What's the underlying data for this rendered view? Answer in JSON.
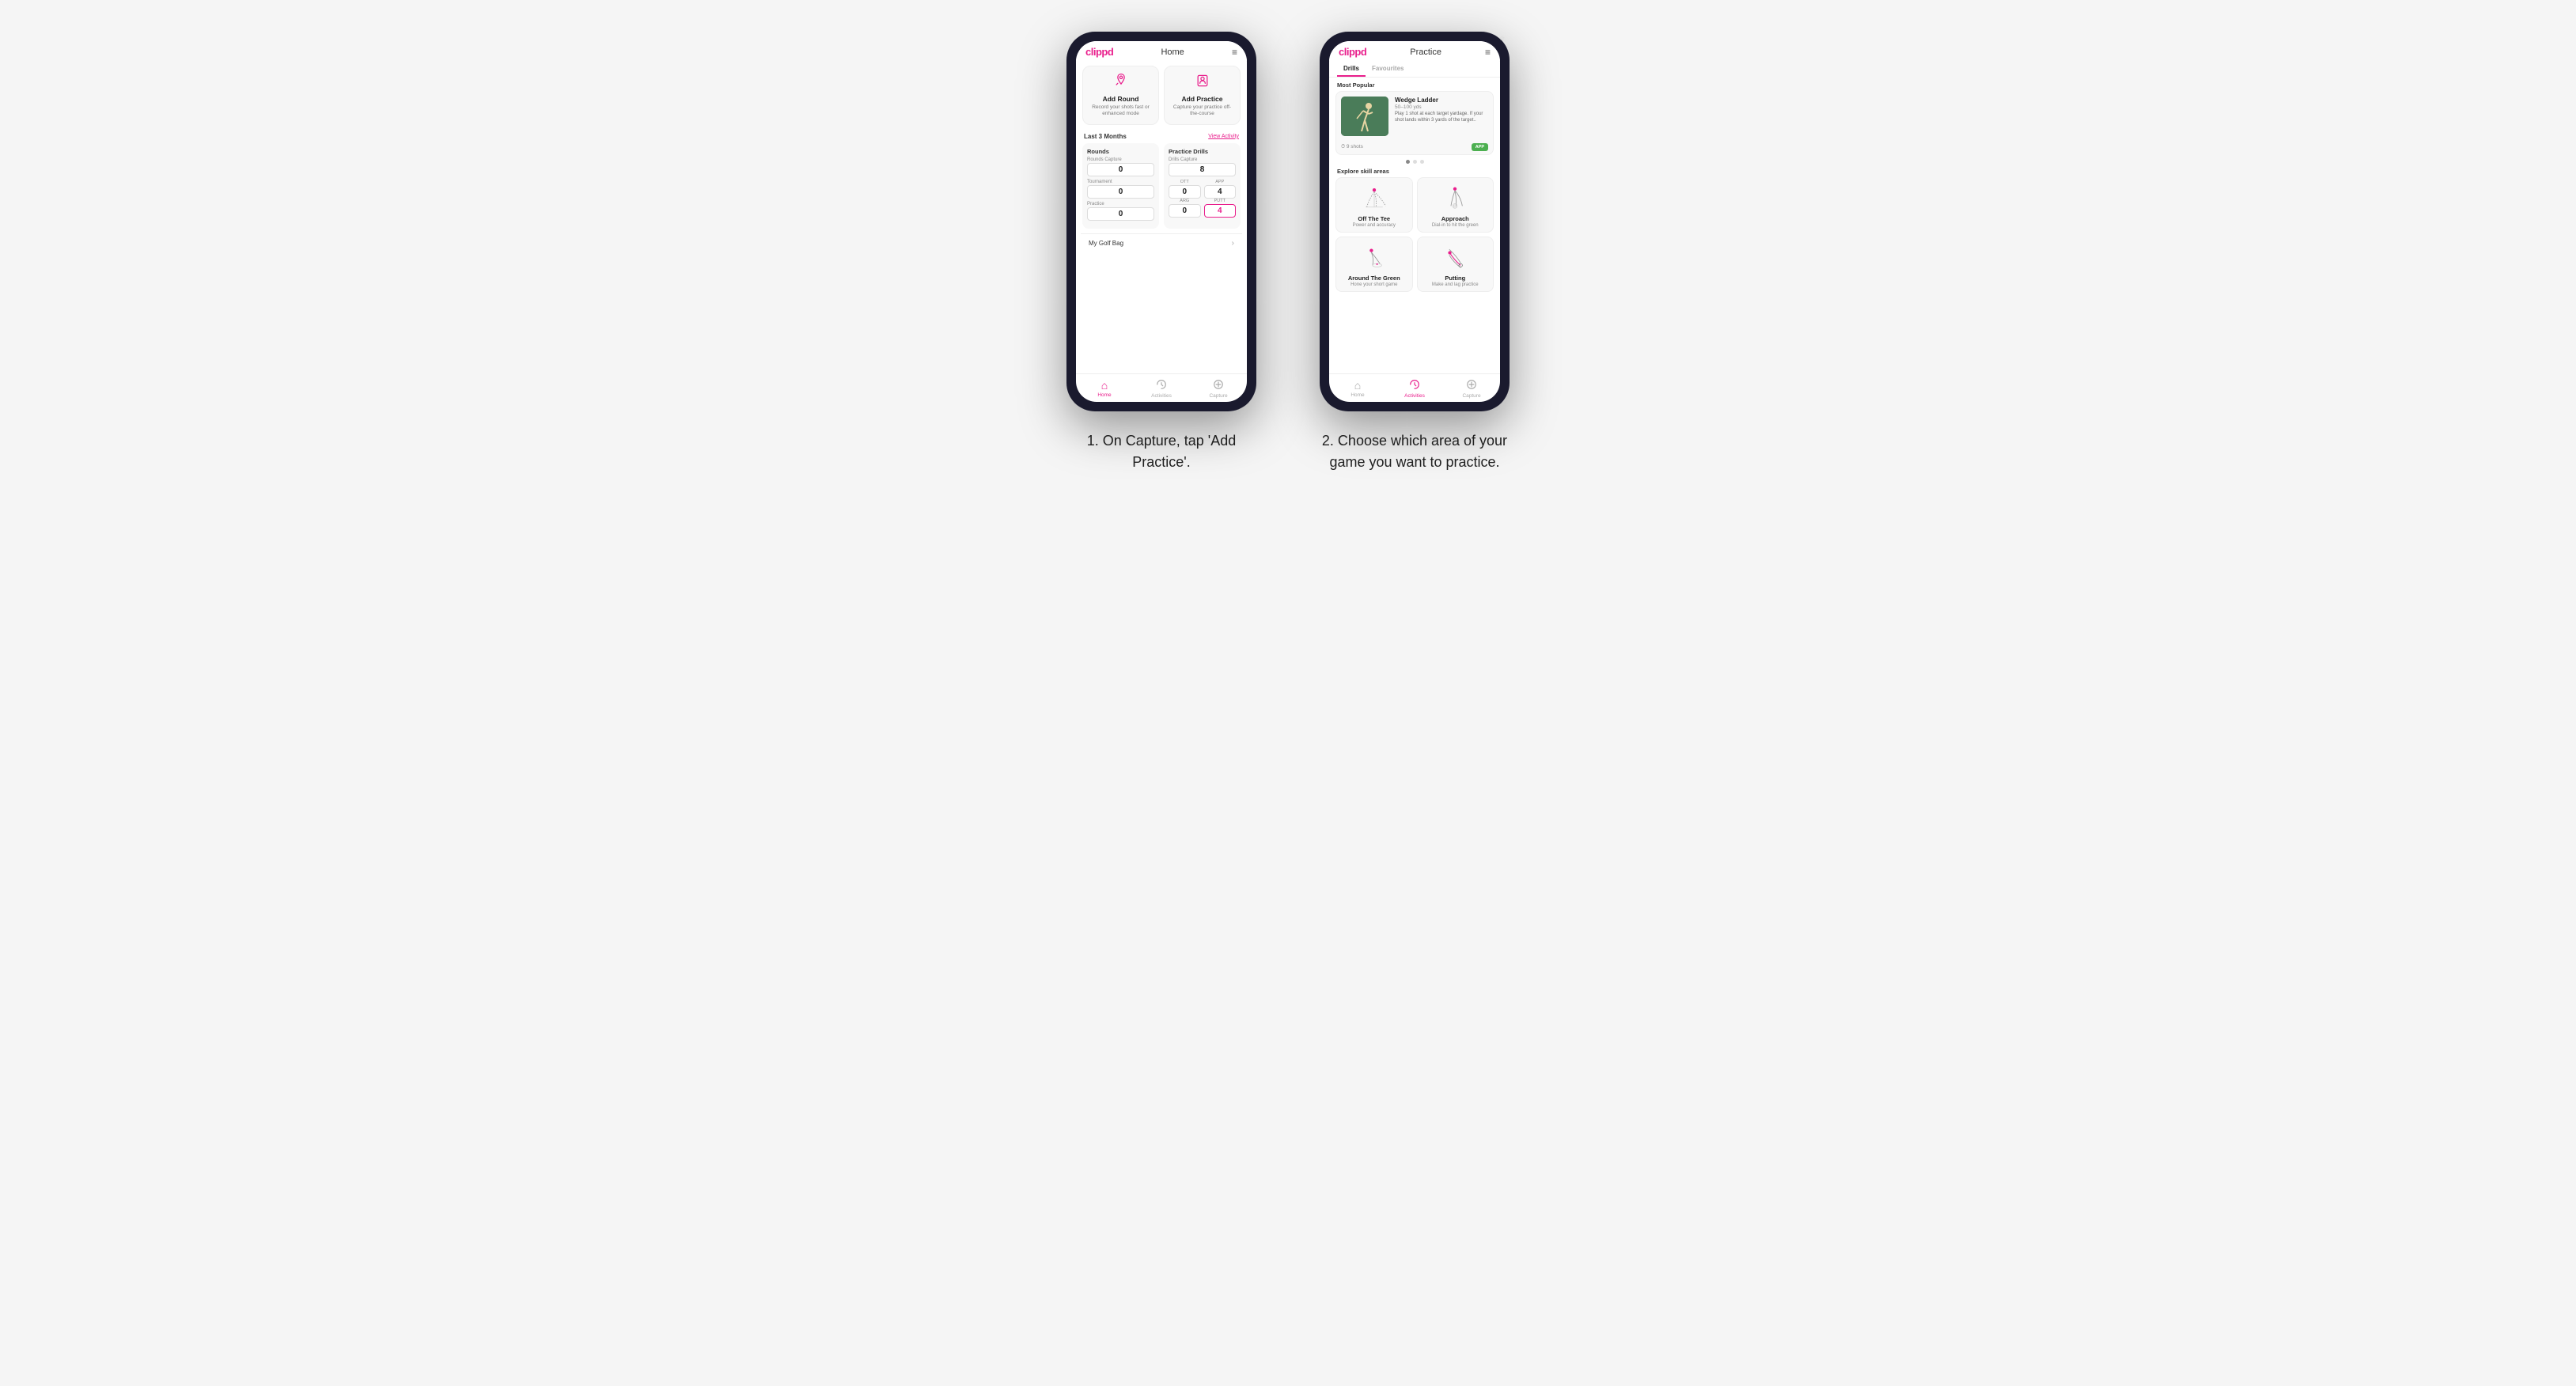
{
  "phone1": {
    "header": {
      "logo": "clippd",
      "title": "Home",
      "menu_icon": "≡"
    },
    "action_cards": [
      {
        "id": "add-round",
        "icon": "⛳",
        "title": "Add Round",
        "subtitle": "Record your shots fast or enhanced mode"
      },
      {
        "id": "add-practice",
        "icon": "🎯",
        "title": "Add Practice",
        "subtitle": "Capture your practice off-the-course"
      }
    ],
    "section": {
      "label": "Last 3 Months",
      "link": "View Activity"
    },
    "rounds": {
      "title": "Rounds",
      "rounds_capture_label": "Rounds Capture",
      "rounds_capture_value": "0",
      "tournament_label": "Tournament",
      "tournament_value": "0",
      "ott_label": "OTT",
      "ott_value": "0",
      "app_label": "APP",
      "app_value": "4",
      "practice_label": "Practice",
      "practice_value": "0"
    },
    "drills": {
      "title": "Practice Drills",
      "drills_capture_label": "Drills Capture",
      "drills_capture_value": "8",
      "arg_label": "ARG",
      "arg_value": "0",
      "putt_label": "PUTT",
      "putt_value": "4"
    },
    "golf_bag": {
      "label": "My Golf Bag",
      "chevron": "›"
    },
    "nav": [
      {
        "id": "home",
        "icon": "⌂",
        "label": "Home",
        "active": true
      },
      {
        "id": "activities",
        "icon": "♻",
        "label": "Activities",
        "active": false
      },
      {
        "id": "capture",
        "icon": "⊕",
        "label": "Capture",
        "active": false
      }
    ]
  },
  "phone2": {
    "header": {
      "logo": "clippd",
      "title": "Practice",
      "menu_icon": "≡"
    },
    "tabs": [
      {
        "id": "drills",
        "label": "Drills",
        "active": true
      },
      {
        "id": "favourites",
        "label": "Favourites",
        "active": false
      }
    ],
    "most_popular_label": "Most Popular",
    "featured": {
      "title": "Wedge Ladder",
      "yards": "50–100 yds",
      "description": "Play 1 shot at each target yardage. If your shot lands within 3 yards of the target..",
      "shots": "9 shots",
      "badge": "APP",
      "dots": [
        true,
        false,
        false
      ]
    },
    "explore_label": "Explore skill areas",
    "skills": [
      {
        "id": "off-the-tee",
        "name": "Off The Tee",
        "desc": "Power and accuracy"
      },
      {
        "id": "approach",
        "name": "Approach",
        "desc": "Dial-in to hit the green"
      },
      {
        "id": "around-the-green",
        "name": "Around The Green",
        "desc": "Hone your short game"
      },
      {
        "id": "putting",
        "name": "Putting",
        "desc": "Make and lag practice"
      }
    ],
    "nav": [
      {
        "id": "home",
        "icon": "⌂",
        "label": "Home",
        "active": false
      },
      {
        "id": "activities",
        "icon": "♻",
        "label": "Activities",
        "active": true
      },
      {
        "id": "capture",
        "icon": "⊕",
        "label": "Capture",
        "active": false
      }
    ]
  },
  "captions": {
    "caption1": "1. On Capture, tap 'Add Practice'.",
    "caption2": "2. Choose which area of your game you want to practice."
  }
}
